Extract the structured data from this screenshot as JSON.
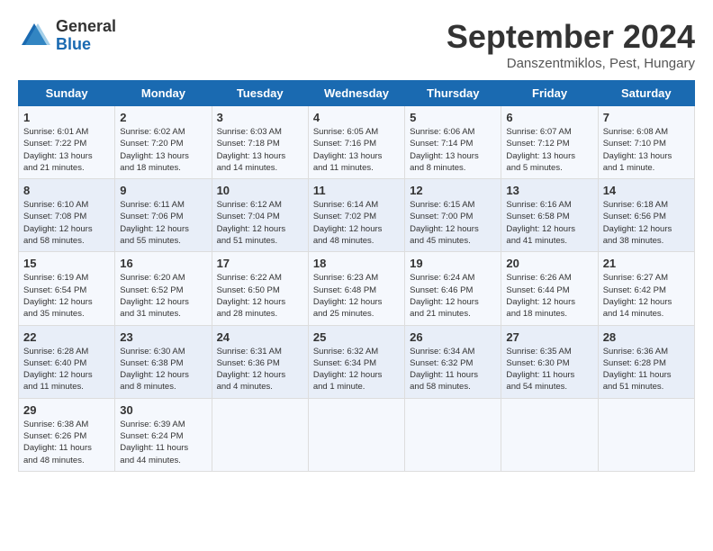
{
  "logo": {
    "general": "General",
    "blue": "Blue"
  },
  "header": {
    "month": "September 2024",
    "location": "Danszentmiklos, Pest, Hungary"
  },
  "weekdays": [
    "Sunday",
    "Monday",
    "Tuesday",
    "Wednesday",
    "Thursday",
    "Friday",
    "Saturday"
  ],
  "weeks": [
    [
      {
        "day": "1",
        "info": "Sunrise: 6:01 AM\nSunset: 7:22 PM\nDaylight: 13 hours\nand 21 minutes."
      },
      {
        "day": "2",
        "info": "Sunrise: 6:02 AM\nSunset: 7:20 PM\nDaylight: 13 hours\nand 18 minutes."
      },
      {
        "day": "3",
        "info": "Sunrise: 6:03 AM\nSunset: 7:18 PM\nDaylight: 13 hours\nand 14 minutes."
      },
      {
        "day": "4",
        "info": "Sunrise: 6:05 AM\nSunset: 7:16 PM\nDaylight: 13 hours\nand 11 minutes."
      },
      {
        "day": "5",
        "info": "Sunrise: 6:06 AM\nSunset: 7:14 PM\nDaylight: 13 hours\nand 8 minutes."
      },
      {
        "day": "6",
        "info": "Sunrise: 6:07 AM\nSunset: 7:12 PM\nDaylight: 13 hours\nand 5 minutes."
      },
      {
        "day": "7",
        "info": "Sunrise: 6:08 AM\nSunset: 7:10 PM\nDaylight: 13 hours\nand 1 minute."
      }
    ],
    [
      {
        "day": "8",
        "info": "Sunrise: 6:10 AM\nSunset: 7:08 PM\nDaylight: 12 hours\nand 58 minutes."
      },
      {
        "day": "9",
        "info": "Sunrise: 6:11 AM\nSunset: 7:06 PM\nDaylight: 12 hours\nand 55 minutes."
      },
      {
        "day": "10",
        "info": "Sunrise: 6:12 AM\nSunset: 7:04 PM\nDaylight: 12 hours\nand 51 minutes."
      },
      {
        "day": "11",
        "info": "Sunrise: 6:14 AM\nSunset: 7:02 PM\nDaylight: 12 hours\nand 48 minutes."
      },
      {
        "day": "12",
        "info": "Sunrise: 6:15 AM\nSunset: 7:00 PM\nDaylight: 12 hours\nand 45 minutes."
      },
      {
        "day": "13",
        "info": "Sunrise: 6:16 AM\nSunset: 6:58 PM\nDaylight: 12 hours\nand 41 minutes."
      },
      {
        "day": "14",
        "info": "Sunrise: 6:18 AM\nSunset: 6:56 PM\nDaylight: 12 hours\nand 38 minutes."
      }
    ],
    [
      {
        "day": "15",
        "info": "Sunrise: 6:19 AM\nSunset: 6:54 PM\nDaylight: 12 hours\nand 35 minutes."
      },
      {
        "day": "16",
        "info": "Sunrise: 6:20 AM\nSunset: 6:52 PM\nDaylight: 12 hours\nand 31 minutes."
      },
      {
        "day": "17",
        "info": "Sunrise: 6:22 AM\nSunset: 6:50 PM\nDaylight: 12 hours\nand 28 minutes."
      },
      {
        "day": "18",
        "info": "Sunrise: 6:23 AM\nSunset: 6:48 PM\nDaylight: 12 hours\nand 25 minutes."
      },
      {
        "day": "19",
        "info": "Sunrise: 6:24 AM\nSunset: 6:46 PM\nDaylight: 12 hours\nand 21 minutes."
      },
      {
        "day": "20",
        "info": "Sunrise: 6:26 AM\nSunset: 6:44 PM\nDaylight: 12 hours\nand 18 minutes."
      },
      {
        "day": "21",
        "info": "Sunrise: 6:27 AM\nSunset: 6:42 PM\nDaylight: 12 hours\nand 14 minutes."
      }
    ],
    [
      {
        "day": "22",
        "info": "Sunrise: 6:28 AM\nSunset: 6:40 PM\nDaylight: 12 hours\nand 11 minutes."
      },
      {
        "day": "23",
        "info": "Sunrise: 6:30 AM\nSunset: 6:38 PM\nDaylight: 12 hours\nand 8 minutes."
      },
      {
        "day": "24",
        "info": "Sunrise: 6:31 AM\nSunset: 6:36 PM\nDaylight: 12 hours\nand 4 minutes."
      },
      {
        "day": "25",
        "info": "Sunrise: 6:32 AM\nSunset: 6:34 PM\nDaylight: 12 hours\nand 1 minute."
      },
      {
        "day": "26",
        "info": "Sunrise: 6:34 AM\nSunset: 6:32 PM\nDaylight: 11 hours\nand 58 minutes."
      },
      {
        "day": "27",
        "info": "Sunrise: 6:35 AM\nSunset: 6:30 PM\nDaylight: 11 hours\nand 54 minutes."
      },
      {
        "day": "28",
        "info": "Sunrise: 6:36 AM\nSunset: 6:28 PM\nDaylight: 11 hours\nand 51 minutes."
      }
    ],
    [
      {
        "day": "29",
        "info": "Sunrise: 6:38 AM\nSunset: 6:26 PM\nDaylight: 11 hours\nand 48 minutes."
      },
      {
        "day": "30",
        "info": "Sunrise: 6:39 AM\nSunset: 6:24 PM\nDaylight: 11 hours\nand 44 minutes."
      },
      null,
      null,
      null,
      null,
      null
    ]
  ]
}
